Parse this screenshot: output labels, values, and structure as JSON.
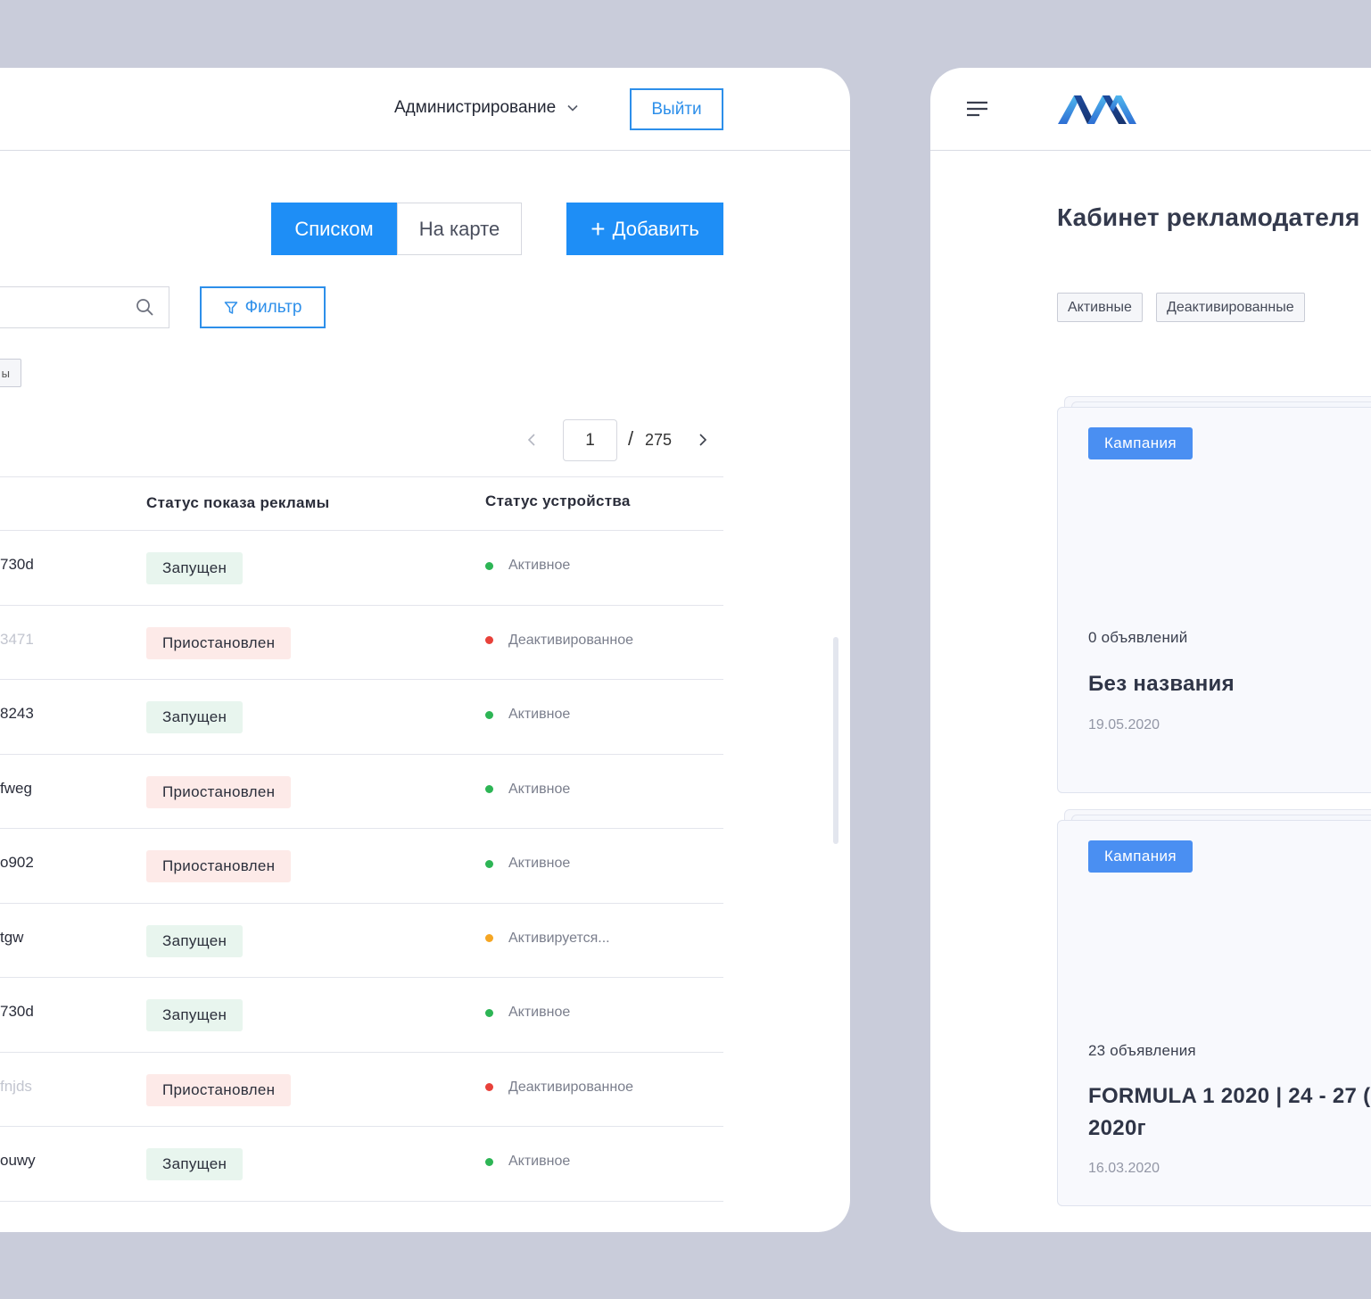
{
  "left": {
    "header": {
      "admin_menu_label": "Администрирование",
      "logout_label": "Выйти"
    },
    "view_toggle": {
      "list_label": "Списком",
      "map_label": "На карте"
    },
    "add_label": "Добавить",
    "search": {
      "placeholder": "",
      "value": ""
    },
    "filter_label": "Фильтр",
    "chip_partial_label": "ы",
    "pager": {
      "current_page": "1",
      "separator": "/",
      "total_pages": "275"
    },
    "table": {
      "columns": [
        "Статус показа рекламы",
        "Статус устройства"
      ],
      "rows": [
        {
          "id": "730d",
          "id_faded": false,
          "ad_status": "Запущен",
          "ad_status_kind": "running",
          "device_status": "Активное",
          "device_color": "#2db555"
        },
        {
          "id": "3471",
          "id_faded": true,
          "ad_status": "Приостановлен",
          "ad_status_kind": "paused",
          "device_status": "Деактивированное",
          "device_color": "#e8413a"
        },
        {
          "id": "8243",
          "id_faded": false,
          "ad_status": "Запущен",
          "ad_status_kind": "running",
          "device_status": "Активное",
          "device_color": "#2db555"
        },
        {
          "id": "fweg",
          "id_faded": false,
          "ad_status": "Приостановлен",
          "ad_status_kind": "paused",
          "device_status": "Активное",
          "device_color": "#2db555"
        },
        {
          "id": "o902",
          "id_faded": false,
          "ad_status": "Приостановлен",
          "ad_status_kind": "paused",
          "device_status": "Активное",
          "device_color": "#2db555"
        },
        {
          "id": "tgw",
          "id_faded": false,
          "ad_status": "Запущен",
          "ad_status_kind": "running",
          "device_status": "Активируется...",
          "device_color": "#f5a623"
        },
        {
          "id": "730d",
          "id_faded": false,
          "ad_status": "Запущен",
          "ad_status_kind": "running",
          "device_status": "Активное",
          "device_color": "#2db555"
        },
        {
          "id": "fnjds",
          "id_faded": true,
          "ad_status": "Приостановлен",
          "ad_status_kind": "paused",
          "device_status": "Деактивированное",
          "device_color": "#e8413a"
        },
        {
          "id": "ouwy",
          "id_faded": false,
          "ad_status": "Запущен",
          "ad_status_kind": "running",
          "device_status": "Активное",
          "device_color": "#2db555"
        }
      ]
    }
  },
  "right": {
    "title": "Кабинет рекламодателя",
    "tabs": [
      "Активные",
      "Деактивированные"
    ],
    "cards": [
      {
        "badge": "Кампания",
        "count": "0 объявлений",
        "name_lines": [
          "Без названия"
        ],
        "date": "19.05.2020"
      },
      {
        "badge": "Кампания",
        "count": "23 объявления",
        "name_lines": [
          "FORMULA 1 2020 | 24 - 27 (",
          "2020г"
        ],
        "date": "16.03.2020"
      }
    ]
  },
  "colors": {
    "accent": "#1e8ef6",
    "outline_accent": "#2d8fea",
    "status_running_bg": "#e8f5ee",
    "status_paused_bg": "#fdeae8",
    "campaign_badge": "#4a8ff2",
    "backdrop": "#c9ccda"
  },
  "icons": [
    "chevron-down-icon",
    "search-icon",
    "filter-icon",
    "chevron-left-icon",
    "chevron-right-icon",
    "plus-icon",
    "hamburger-menu-icon",
    "ava-logo"
  ]
}
